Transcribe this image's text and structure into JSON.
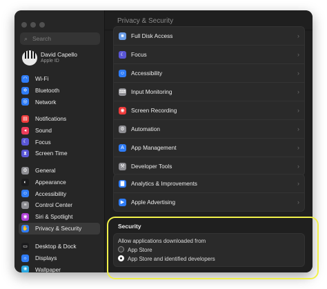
{
  "window": {
    "title": "Privacy & Security"
  },
  "search": {
    "placeholder": "Search",
    "icon": "magnifying-glass"
  },
  "account": {
    "name": "David Capello",
    "subtitle": "Apple ID"
  },
  "sidebar": {
    "groups": [
      {
        "items": [
          {
            "label": "Wi-Fi",
            "icon": "wifi",
            "color": "#2f7cf6"
          },
          {
            "label": "Bluetooth",
            "icon": "bluetooth",
            "color": "#2f7cf6"
          },
          {
            "label": "Network",
            "icon": "globe",
            "color": "#2f7cf6"
          }
        ]
      },
      {
        "items": [
          {
            "label": "Notifications",
            "icon": "bell",
            "color": "#ee3b3b"
          },
          {
            "label": "Sound",
            "icon": "speaker",
            "color": "#ee3b5a"
          },
          {
            "label": "Focus",
            "icon": "moon",
            "color": "#5a57d6"
          },
          {
            "label": "Screen Time",
            "icon": "hourglass",
            "color": "#5a57d6"
          }
        ]
      },
      {
        "items": [
          {
            "label": "General",
            "icon": "gear",
            "color": "#8e8e93"
          },
          {
            "label": "Appearance",
            "icon": "circle-half",
            "color": "#1c1c1e"
          },
          {
            "label": "Accessibility",
            "icon": "accessibility",
            "color": "#2f7cf6"
          },
          {
            "label": "Control Center",
            "icon": "switches",
            "color": "#8e8e93"
          },
          {
            "label": "Siri & Spotlight",
            "icon": "siri",
            "color": "#b13fd6"
          },
          {
            "label": "Privacy & Security",
            "icon": "hand",
            "color": "#2f7cf6",
            "active": true
          }
        ]
      },
      {
        "items": [
          {
            "label": "Desktop & Dock",
            "icon": "dock",
            "color": "#1c1c1e"
          },
          {
            "label": "Displays",
            "icon": "sun",
            "color": "#2f7cf6"
          },
          {
            "label": "Wallpaper",
            "icon": "photo",
            "color": "#2aa7e0"
          }
        ]
      }
    ]
  },
  "privacy": {
    "group1": [
      {
        "label": "Full Disk Access",
        "icon": "folder",
        "color": "#6c9ee8"
      },
      {
        "label": "Focus",
        "icon": "moon",
        "color": "#5a57d6"
      },
      {
        "label": "Accessibility",
        "icon": "accessibility",
        "color": "#2f7cf6"
      },
      {
        "label": "Input Monitoring",
        "icon": "keyboard",
        "color": "#8e8e93"
      },
      {
        "label": "Screen Recording",
        "icon": "record",
        "color": "#ee3b3b"
      },
      {
        "label": "Automation",
        "icon": "gears",
        "color": "#8e8e93"
      },
      {
        "label": "App Management",
        "icon": "app-store",
        "color": "#2f7cf6"
      },
      {
        "label": "Developer Tools",
        "icon": "hammer",
        "color": "#8e8e93"
      }
    ],
    "group2": [
      {
        "label": "Analytics & Improvements",
        "icon": "chart",
        "color": "#2f7cf6"
      },
      {
        "label": "Apple Advertising",
        "icon": "megaphone",
        "color": "#2f7cf6"
      }
    ]
  },
  "security": {
    "heading": "Security",
    "allow_label": "Allow applications downloaded from",
    "options": [
      {
        "label": "App Store",
        "selected": false
      },
      {
        "label": "App Store and identified developers",
        "selected": true
      }
    ]
  },
  "highlight_color": "#f1f14a"
}
